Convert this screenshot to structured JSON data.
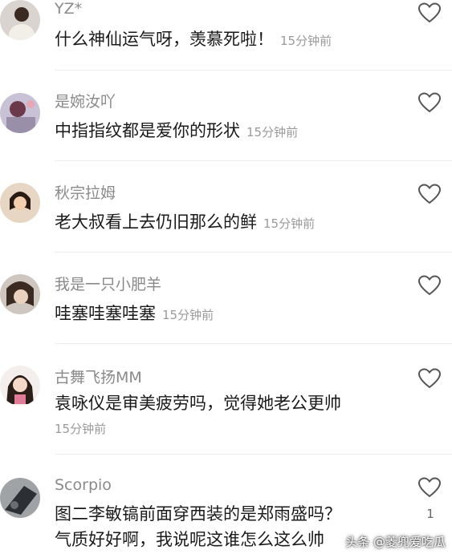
{
  "comments": [
    {
      "username": "YZ*",
      "text": "什么神仙运气呀，羡慕死啦！",
      "time": "15分钟前"
    },
    {
      "username": "是婉汝吖",
      "text": "中指指纹都是爱你的形状",
      "time": "15分钟前"
    },
    {
      "username": "秋宗拉姆",
      "text": "老大叔看上去仍旧那么的鲜",
      "time": "15分钟前"
    },
    {
      "username": "我是一只小肥羊",
      "text": "哇塞哇塞哇塞",
      "time": "15分钟前"
    },
    {
      "username": "古舞飞扬MM",
      "text": "袁咏仪是审美疲劳吗，觉得她老公更帅",
      "time": "15分钟前"
    },
    {
      "username": "Scorpio",
      "text_line1": "图二李敏镐前面穿西装的是郑雨盛吗？",
      "text_line2": "气质好好啊，我说呢这谁怎么这么帅",
      "likes": "1"
    }
  ],
  "watermark": "头条 @菱兜爱吃瓜",
  "icons": {
    "like": "heart-outline-icon"
  },
  "colors": {
    "username": "#8a8a8a",
    "text": "#1a1a1a",
    "time": "#9a9a9a"
  }
}
